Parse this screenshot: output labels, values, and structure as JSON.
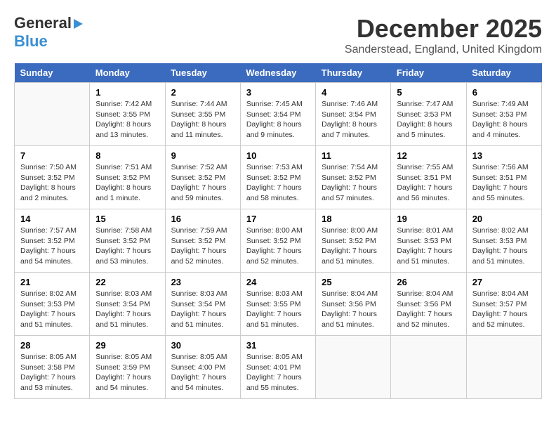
{
  "header": {
    "logo_line1": "General",
    "logo_line2": "Blue",
    "month": "December 2025",
    "location": "Sanderstead, England, United Kingdom"
  },
  "weekdays": [
    "Sunday",
    "Monday",
    "Tuesday",
    "Wednesday",
    "Thursday",
    "Friday",
    "Saturday"
  ],
  "weeks": [
    [
      {
        "day": "",
        "info": ""
      },
      {
        "day": "1",
        "info": "Sunrise: 7:42 AM\nSunset: 3:55 PM\nDaylight: 8 hours\nand 13 minutes."
      },
      {
        "day": "2",
        "info": "Sunrise: 7:44 AM\nSunset: 3:55 PM\nDaylight: 8 hours\nand 11 minutes."
      },
      {
        "day": "3",
        "info": "Sunrise: 7:45 AM\nSunset: 3:54 PM\nDaylight: 8 hours\nand 9 minutes."
      },
      {
        "day": "4",
        "info": "Sunrise: 7:46 AM\nSunset: 3:54 PM\nDaylight: 8 hours\nand 7 minutes."
      },
      {
        "day": "5",
        "info": "Sunrise: 7:47 AM\nSunset: 3:53 PM\nDaylight: 8 hours\nand 5 minutes."
      },
      {
        "day": "6",
        "info": "Sunrise: 7:49 AM\nSunset: 3:53 PM\nDaylight: 8 hours\nand 4 minutes."
      }
    ],
    [
      {
        "day": "7",
        "info": "Sunrise: 7:50 AM\nSunset: 3:52 PM\nDaylight: 8 hours\nand 2 minutes."
      },
      {
        "day": "8",
        "info": "Sunrise: 7:51 AM\nSunset: 3:52 PM\nDaylight: 8 hours\nand 1 minute."
      },
      {
        "day": "9",
        "info": "Sunrise: 7:52 AM\nSunset: 3:52 PM\nDaylight: 7 hours\nand 59 minutes."
      },
      {
        "day": "10",
        "info": "Sunrise: 7:53 AM\nSunset: 3:52 PM\nDaylight: 7 hours\nand 58 minutes."
      },
      {
        "day": "11",
        "info": "Sunrise: 7:54 AM\nSunset: 3:52 PM\nDaylight: 7 hours\nand 57 minutes."
      },
      {
        "day": "12",
        "info": "Sunrise: 7:55 AM\nSunset: 3:51 PM\nDaylight: 7 hours\nand 56 minutes."
      },
      {
        "day": "13",
        "info": "Sunrise: 7:56 AM\nSunset: 3:51 PM\nDaylight: 7 hours\nand 55 minutes."
      }
    ],
    [
      {
        "day": "14",
        "info": "Sunrise: 7:57 AM\nSunset: 3:52 PM\nDaylight: 7 hours\nand 54 minutes."
      },
      {
        "day": "15",
        "info": "Sunrise: 7:58 AM\nSunset: 3:52 PM\nDaylight: 7 hours\nand 53 minutes."
      },
      {
        "day": "16",
        "info": "Sunrise: 7:59 AM\nSunset: 3:52 PM\nDaylight: 7 hours\nand 52 minutes."
      },
      {
        "day": "17",
        "info": "Sunrise: 8:00 AM\nSunset: 3:52 PM\nDaylight: 7 hours\nand 52 minutes."
      },
      {
        "day": "18",
        "info": "Sunrise: 8:00 AM\nSunset: 3:52 PM\nDaylight: 7 hours\nand 51 minutes."
      },
      {
        "day": "19",
        "info": "Sunrise: 8:01 AM\nSunset: 3:53 PM\nDaylight: 7 hours\nand 51 minutes."
      },
      {
        "day": "20",
        "info": "Sunrise: 8:02 AM\nSunset: 3:53 PM\nDaylight: 7 hours\nand 51 minutes."
      }
    ],
    [
      {
        "day": "21",
        "info": "Sunrise: 8:02 AM\nSunset: 3:53 PM\nDaylight: 7 hours\nand 51 minutes."
      },
      {
        "day": "22",
        "info": "Sunrise: 8:03 AM\nSunset: 3:54 PM\nDaylight: 7 hours\nand 51 minutes."
      },
      {
        "day": "23",
        "info": "Sunrise: 8:03 AM\nSunset: 3:54 PM\nDaylight: 7 hours\nand 51 minutes."
      },
      {
        "day": "24",
        "info": "Sunrise: 8:03 AM\nSunset: 3:55 PM\nDaylight: 7 hours\nand 51 minutes."
      },
      {
        "day": "25",
        "info": "Sunrise: 8:04 AM\nSunset: 3:56 PM\nDaylight: 7 hours\nand 51 minutes."
      },
      {
        "day": "26",
        "info": "Sunrise: 8:04 AM\nSunset: 3:56 PM\nDaylight: 7 hours\nand 52 minutes."
      },
      {
        "day": "27",
        "info": "Sunrise: 8:04 AM\nSunset: 3:57 PM\nDaylight: 7 hours\nand 52 minutes."
      }
    ],
    [
      {
        "day": "28",
        "info": "Sunrise: 8:05 AM\nSunset: 3:58 PM\nDaylight: 7 hours\nand 53 minutes."
      },
      {
        "day": "29",
        "info": "Sunrise: 8:05 AM\nSunset: 3:59 PM\nDaylight: 7 hours\nand 54 minutes."
      },
      {
        "day": "30",
        "info": "Sunrise: 8:05 AM\nSunset: 4:00 PM\nDaylight: 7 hours\nand 54 minutes."
      },
      {
        "day": "31",
        "info": "Sunrise: 8:05 AM\nSunset: 4:01 PM\nDaylight: 7 hours\nand 55 minutes."
      },
      {
        "day": "",
        "info": ""
      },
      {
        "day": "",
        "info": ""
      },
      {
        "day": "",
        "info": ""
      }
    ]
  ]
}
